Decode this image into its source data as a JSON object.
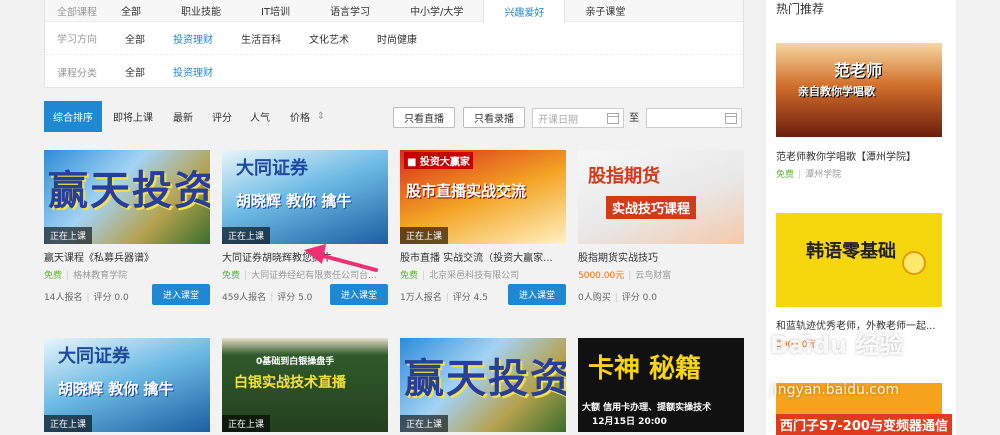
{
  "filters": {
    "tabs_label": "全部课程",
    "tabs": [
      "全部",
      "职业技能",
      "IT培训",
      "语言学习",
      "中小学/大学",
      "兴趣爱好",
      "亲子课堂"
    ],
    "active_tab_index": 5,
    "direction_label": "学习方向",
    "directions": [
      "全部",
      "投资理财",
      "生活百科",
      "文化艺术",
      "时尚健康"
    ],
    "category_label": "课程分类",
    "categories": [
      "全部",
      "投资理财"
    ]
  },
  "sortbar": {
    "comprehensive": "综合排序",
    "upcoming": "即将上课",
    "newest": "最新",
    "rating": "评分",
    "popularity": "人气",
    "price": "价格",
    "price_arrows": "⇕",
    "live_only": "只看直播",
    "recorded_only": "只看录播",
    "start_date_placeholder": "开课日期",
    "to": "至"
  },
  "courses": [
    {
      "title": "赢天课程《私募兵器谱》",
      "price": "免费",
      "paid": false,
      "org": "格林教育学院",
      "enrolled": "14人报名",
      "rating": "评分 0.0",
      "status": "正在上课",
      "enter": "进入课堂",
      "thumb_text": "赢天投资"
    },
    {
      "title": "大同证券胡晓辉教您擒牛",
      "price": "免费",
      "paid": false,
      "org": "大同证券经纪有限责任公司台...",
      "enrolled": "459人报名",
      "rating": "评分 5.0",
      "status": "正在上课",
      "enter": "进入课堂",
      "thumb_text": "大同证券"
    },
    {
      "title": "股市直播 实战交流（投资大赢家...",
      "price": "免费",
      "paid": false,
      "org": "北京采邑科技有限公司",
      "enrolled": "1万人报名",
      "rating": "评分 4.5",
      "status": "正在上课",
      "enter": "进入课堂",
      "thumb_text": "股市直播实战交流"
    },
    {
      "title": "股指期货实战技巧",
      "price": "5000.00元",
      "paid": true,
      "org": "云鸟财富",
      "enrolled": "0人购买",
      "rating": "评分 0.0",
      "status": "",
      "enter": "",
      "thumb_text": "股指期货"
    },
    {
      "title": "",
      "status": "正在上课",
      "thumb_text": "大同证券"
    },
    {
      "title": "",
      "status": "正在上课",
      "thumb_text": "白银实战技术直播"
    },
    {
      "title": "",
      "status": "正在上课",
      "thumb_text": "赢天投资"
    },
    {
      "title": "",
      "status": "",
      "thumb_text": "卡神 秘籍"
    }
  ],
  "sidebar": {
    "title": "热门推荐",
    "items": [
      {
        "title": "范老师教你学唱歌【潭州学院】",
        "price": "免费",
        "paid": false,
        "org": "潭州学院",
        "thumb_text": "范老师"
      },
      {
        "title": "和蓝轨迹优秀老师，外教老师一起...",
        "price": "300.00元",
        "paid": true,
        "org": "",
        "thumb_text": "韩语零基础"
      }
    ]
  },
  "watermark": {
    "brand": "Baidu 经验",
    "url": "jingyan.baidu.com",
    "ad": "西门子S7-200与变频器通信"
  }
}
